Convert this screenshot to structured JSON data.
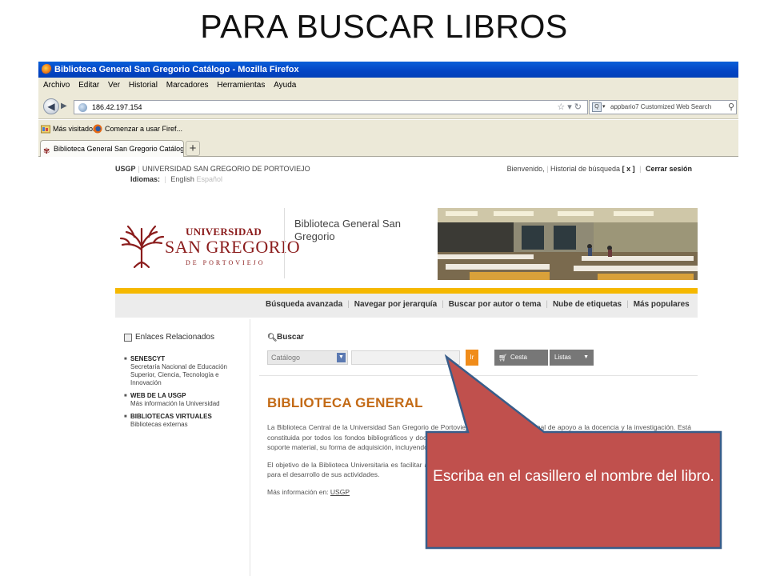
{
  "slide": {
    "title": "PARA BUSCAR LIBROS"
  },
  "browser": {
    "window_title": "Biblioteca General San Gregorio Catálogo - Mozilla Firefox",
    "menu": [
      "Archivo",
      "Editar",
      "Ver",
      "Historial",
      "Marcadores",
      "Herramientas",
      "Ayuda"
    ],
    "url": "186.42.197.154",
    "search_placeholder": "appbario7 Customized Web Search",
    "bookmarks": [
      "Más visitados",
      "Comenzar a usar Firef..."
    ],
    "tab_title": "Biblioteca General San Gregorio Catálogo",
    "new_tab": "+"
  },
  "site": {
    "top_left": {
      "usgp": "USGP",
      "university": "UNIVERSIDAD SAN GREGORIO DE PORTOVIEJO",
      "idiomas": "Idiomas:",
      "english": "English",
      "espanol": "Español"
    },
    "top_right": {
      "welcome": "Bienvenido,",
      "history": "Historial de búsqueda",
      "history_close": "[ x ]",
      "logout": "Cerrar sesión"
    },
    "logo": {
      "line1": "UNIVERSIDAD",
      "line2": "SAN GREGORIO",
      "line3": "DE PORTOVIEJO"
    },
    "library_name": "Biblioteca General San Gregorio",
    "nav": [
      "Búsqueda avanzada",
      "Navegar por jerarquía",
      "Buscar por autor o tema",
      "Nube de etiquetas",
      "Más populares"
    ],
    "sidebar": {
      "title": "Enlaces Relacionados",
      "links": [
        {
          "name": "SENESCYT",
          "desc": "Secretaría Nacional de Educación Superior, Ciencia, Tecnología e Innovación"
        },
        {
          "name": "WEB DE LA USGP",
          "desc": "Más información la Universidad"
        },
        {
          "name": "BIBLIOTECAS VIRTUALES",
          "desc": "Bibliotecas externas"
        }
      ]
    },
    "search": {
      "label": "Buscar",
      "catalog": "Catálogo",
      "go": "Ir",
      "cart": "Cesta",
      "lists": "Listas"
    },
    "content": {
      "heading": "BIBLIOTECA GENERAL",
      "p1": "La Biblioteca Central de la Universidad San Gregorio de Portoviejo es una unidad funcional de apoyo a la docencia y la investigación. Está constituida por todos los fondos bibliográficos y documentales de Facultades, Departamentos, Centros y Servicios, cualquiera que sea su soporte material, su forma de adquisición, incluyendo legados, donaciones e intercambios, y los adquiridos por la Universidad.",
      "p2": "El objetivo de la Biblioteca Universitaria es facilitar a los usuarios el acceso a la información científica, técnica y profesional que requieran para el desarrollo de sus actividades.",
      "more_label": "Más información en:",
      "more_link": "USGP"
    }
  },
  "callout": {
    "text": "Escriba en el casillero el nombre del libro.",
    "fill": "#c0504d",
    "border": "#385d8a"
  }
}
